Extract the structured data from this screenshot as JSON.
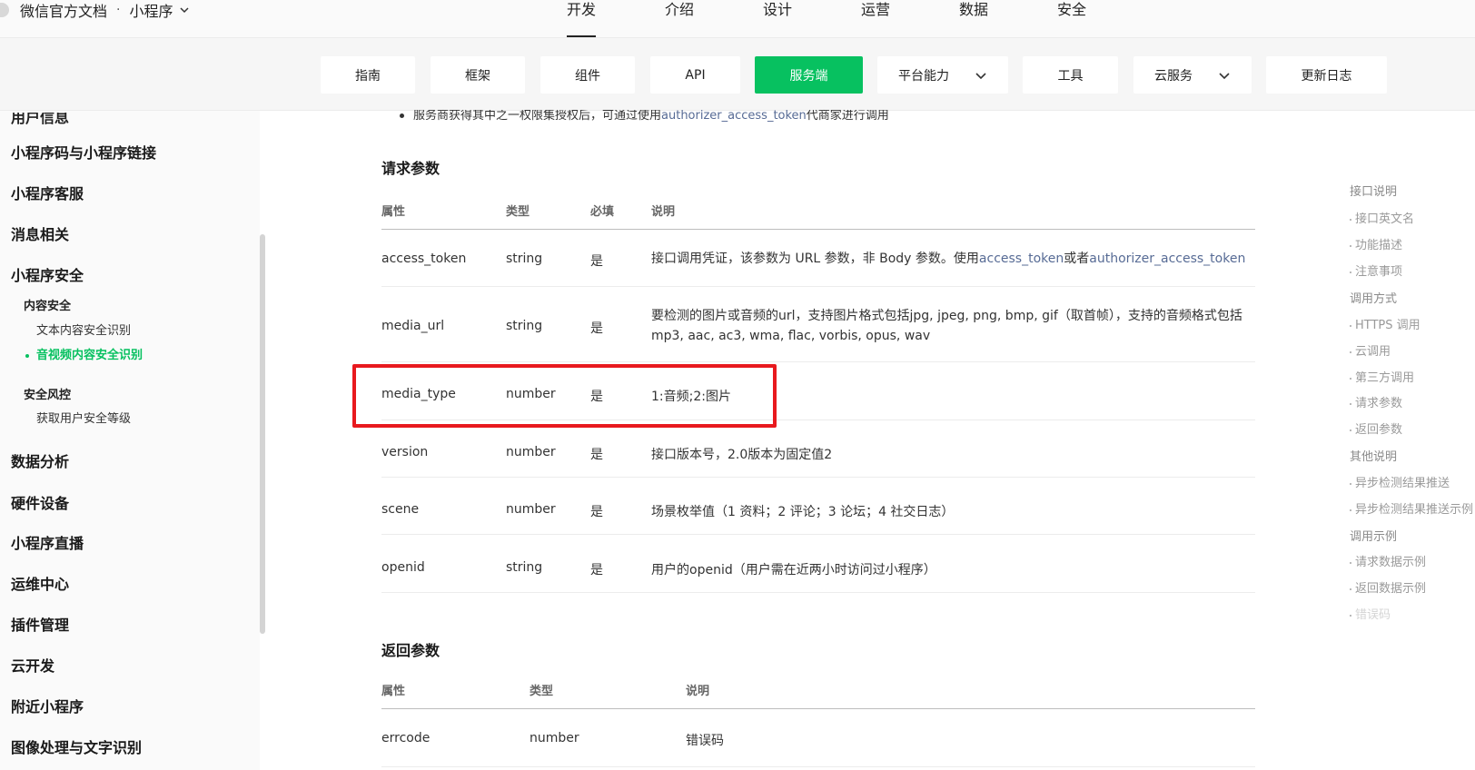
{
  "header": {
    "brand_title": "微信官方文档",
    "brand_separator": "·",
    "brand_sub": "小程序",
    "nav": [
      "开发",
      "介绍",
      "设计",
      "运营",
      "数据",
      "安全"
    ],
    "active_nav": "开发"
  },
  "subnav": {
    "items": [
      "指南",
      "框架",
      "组件",
      "API",
      "服务端",
      "平台能力",
      "工具",
      "云服务",
      "更新日志"
    ],
    "active": "服务端"
  },
  "sidebar": {
    "cut_item": "用户信息",
    "items": [
      "小程序码与小程序链接",
      "小程序客服",
      "消息相关",
      "小程序安全"
    ],
    "security_groups": [
      {
        "label": "内容安全",
        "children": [
          "文本内容安全识别",
          "音视频内容安全识别"
        ]
      },
      {
        "label": "安全风控",
        "children": [
          "获取用户安全等级"
        ]
      }
    ],
    "active_item": "音视频内容安全识别",
    "items_after": [
      "数据分析",
      "硬件设备",
      "小程序直播",
      "运维中心",
      "插件管理",
      "云开发",
      "附近小程序",
      "图像处理与文字识别"
    ]
  },
  "content": {
    "bullet_prefix": "服务商获得其中之一权限集授权后，可通过使用",
    "bullet_link": "authorizer_access_token",
    "bullet_suffix": "代商家进行调用",
    "request_title": "请求参数",
    "request_headers": [
      "属性",
      "类型",
      "必填",
      "说明"
    ],
    "request_rows": [
      {
        "name": "access_token",
        "type": "string",
        "required": "是",
        "desc_prefix": "接口调用凭证，该参数为 URL 参数，非 Body 参数。使用",
        "desc_link1": "access_token",
        "desc_mid": "或者",
        "desc_link2": "authorizer_access_token"
      },
      {
        "name": "media_url",
        "type": "string",
        "required": "是",
        "desc_line1": "要检测的图片或音频的url，支持图片格式包括jpg, jpeg, png, bmp, gif（取首帧），支持的音频格式包括",
        "desc_line2": "mp3, aac, ac3, wma, flac, vorbis, opus, wav"
      },
      {
        "name": "media_type",
        "type": "number",
        "required": "是",
        "desc": "1:音频;2:图片"
      },
      {
        "name": "version",
        "type": "number",
        "required": "是",
        "desc": "接口版本号，2.0版本为固定值2"
      },
      {
        "name": "scene",
        "type": "number",
        "required": "是",
        "desc": "场景枚举值（1 资料；2 评论；3 论坛；4 社交日志）"
      },
      {
        "name": "openid",
        "type": "string",
        "required": "是",
        "desc": "用户的openid（用户需在近两小时访问过小程序）"
      }
    ],
    "response_title": "返回参数",
    "response_headers": [
      "属性",
      "类型",
      "说明"
    ],
    "response_rows": [
      {
        "name": "errcode",
        "type": "number",
        "desc": "错误码"
      }
    ]
  },
  "toc": {
    "entries": [
      {
        "text": "接口说明",
        "level": 1
      },
      {
        "text": "接口英文名",
        "level": 2
      },
      {
        "text": "功能描述",
        "level": 2
      },
      {
        "text": "注意事项",
        "level": 2
      },
      {
        "text": "调用方式",
        "level": 1
      },
      {
        "text": "HTTPS 调用",
        "level": 2
      },
      {
        "text": "云调用",
        "level": 2
      },
      {
        "text": "第三方调用",
        "level": 2
      },
      {
        "text": "请求参数",
        "level": 2
      },
      {
        "text": "返回参数",
        "level": 2
      },
      {
        "text": "其他说明",
        "level": 1
      },
      {
        "text": "异步检测结果推送",
        "level": 2
      },
      {
        "text": "异步检测结果推送示例",
        "level": 2
      },
      {
        "text": "调用示例",
        "level": 1
      },
      {
        "text": "请求数据示例",
        "level": 2
      },
      {
        "text": "返回数据示例",
        "level": 2
      },
      {
        "text": "错误码",
        "level": 2
      }
    ]
  },
  "colors": {
    "accent": "#07c160",
    "highlight": "#e8191e",
    "link": "#576b95"
  }
}
